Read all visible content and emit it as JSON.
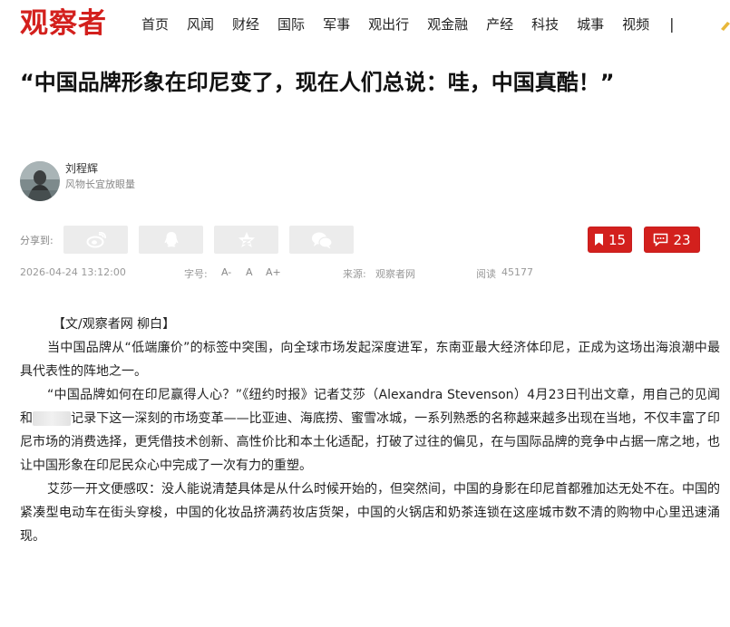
{
  "header": {
    "logo": "观察者",
    "nav": [
      "首页",
      "风闻",
      "财经",
      "国际",
      "军事",
      "观出行",
      "观金融",
      "产经",
      "科技",
      "城事",
      "视频"
    ],
    "separator": "|"
  },
  "article": {
    "title": "“中国品牌形象在印尼变了，现在人们总说：哇，中国真酷！”",
    "author": {
      "name": "刘程辉",
      "desc": "风物长宜放眼量"
    },
    "share_label": "分享到:",
    "share_icons": [
      "weibo-icon",
      "qq-icon",
      "qzone-icon",
      "wechat-icon"
    ],
    "bookmark_count": "15",
    "comment_count": "23",
    "meta": {
      "datetime": "2026-04-24 13:12:00",
      "font_label": "字号:",
      "font_small": "A-",
      "font_normal": "A",
      "font_large": "A+",
      "source_label": "来源:",
      "source": "观察者网",
      "views_label": "阅读",
      "views": "45177"
    },
    "byline": "【文/观察者网 柳白】",
    "paragraphs": [
      "当中国品牌从“低端廉价”的标签中突围，向全球市场发起深度进军，东南亚最大经济体印尼，正成为这场出海浪潮中最具代表性的阵地之一。",
      "“中国品牌如何在印尼赢得人心？”《纽约时报》记者艾莎（Alexandra Stevenson）4月23日刊出文章，用自己的见闻和",
      "记录下这一深刻的市场变革——比亚迪、海底捞、蜜雪冰城，一系列熟悉的名称越来越多出现在当地，不仅丰富了印尼市场的消费选择，更凭借技术创新、高性价比和本土化适配，打破了过往的偏见，在与国际品牌的竞争中占据一席之地，也让中国形象在印尼民众心中完成了一次有力的重塑。",
      "艾莎一开文便感叹：没人能说清楚具体是从什么时候开始的，但突然间，中国的身影在印尼首都雅加达无处不在。中国的紧凑型电动车在街头穿梭，中国的化妆品挤满药妆店货架，中国的火锅店和奶茶连锁在这座城市数不清的购物中心里迅速涌现。"
    ]
  },
  "colors": {
    "brand": "#d3201d",
    "share_bg": "#ececec",
    "meta_text": "#999999"
  }
}
